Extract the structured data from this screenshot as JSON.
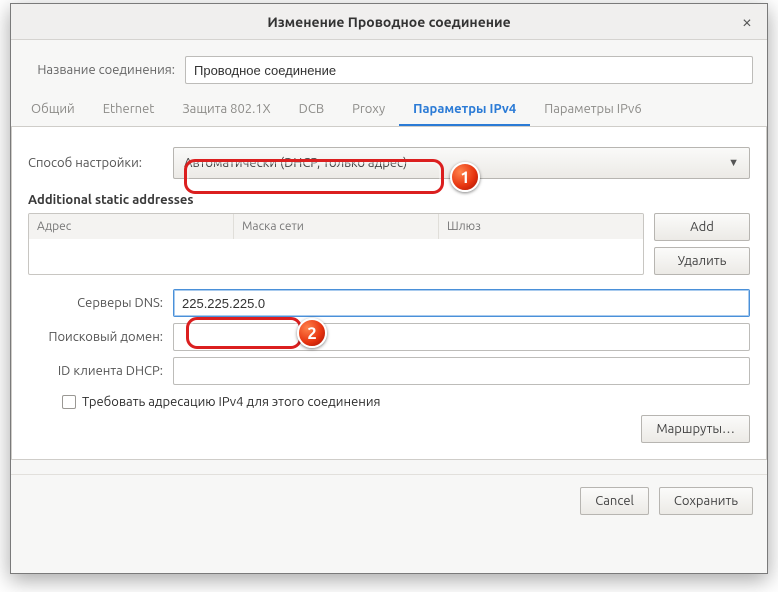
{
  "window": {
    "title": "Изменение Проводное соединение"
  },
  "connection": {
    "name_label": "Название соединения:",
    "name_value": "Проводное соединение"
  },
  "tabs": {
    "items": [
      {
        "label": "Общий"
      },
      {
        "label": "Ethernet"
      },
      {
        "label": "Защита 802.1X"
      },
      {
        "label": "DCB"
      },
      {
        "label": "Proxy"
      },
      {
        "label": "Параметры IPv4"
      },
      {
        "label": "Параметры IPv6"
      }
    ],
    "active_index": 5
  },
  "ipv4": {
    "method_label": "Способ настройки:",
    "method_value": "Автоматически (DHCP, только адрес)",
    "addresses_title": "Additional static addresses",
    "table": {
      "col_address": "Адрес",
      "col_netmask": "Маска сети",
      "col_gateway": "Шлюз"
    },
    "buttons": {
      "add": "Add",
      "delete": "Удалить"
    },
    "dns_label": "Серверы DNS:",
    "dns_value": "225.225.225.0",
    "search_label": "Поисковый домен:",
    "search_value": "",
    "dhcp_client_label": "ID клиента DHCP:",
    "dhcp_client_value": "",
    "require_ipv4_label": "Требовать адресацию IPv4 для этого соединения",
    "routes_btn": "Маршруты…"
  },
  "dialog": {
    "cancel": "Cancel",
    "save": "Сохранить"
  },
  "callouts": {
    "one": "1",
    "two": "2"
  }
}
